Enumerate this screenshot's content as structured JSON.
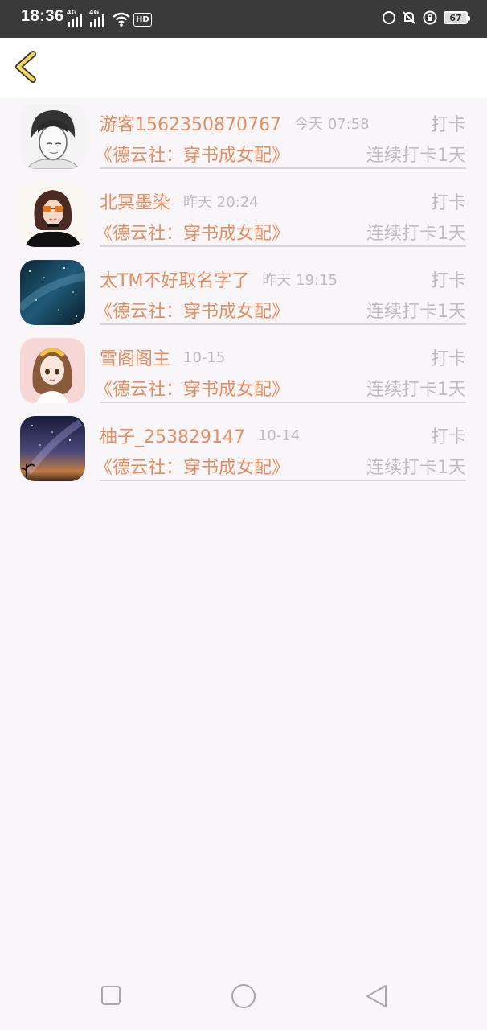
{
  "status_bar": {
    "time": "18:36",
    "network_1": "4G",
    "network_2": "4G",
    "hd": "HD",
    "battery": "67",
    "icons": [
      "signal-icon",
      "signal-icon",
      "wifi-icon",
      "hd-icon",
      "face-icon",
      "bell-off-icon",
      "lock-rotation-icon",
      "battery-icon"
    ]
  },
  "header": {
    "back_icon": "chevron-left-icon",
    "accent_color": "#e8c54a"
  },
  "colors": {
    "name": "#e78d5f",
    "muted": "#bdbdbd",
    "divider": "#d6d6d6",
    "background": "#f8f6f8"
  },
  "checkins": [
    {
      "name": "游客1562350870767",
      "time": "今天 07:58",
      "tag": "打卡",
      "book": "《德云社：穿书成女配》",
      "streak": "连续打卡1天",
      "avatar": "avatar-sketch-boy"
    },
    {
      "name": "北冥墨染",
      "time": "昨天 20:24",
      "tag": "打卡",
      "book": "《德云社：穿书成女配》",
      "streak": "连续打卡1天",
      "avatar": "avatar-girl-sunglasses"
    },
    {
      "name": "太TM不好取名字了",
      "time": "昨天 19:15",
      "tag": "打卡",
      "book": "《德云社：穿书成女配》",
      "streak": "连续打卡1天",
      "avatar": "avatar-starry-sky"
    },
    {
      "name": "雪阁阁主",
      "time": "10-15",
      "tag": "打卡",
      "book": "《德云社：穿书成女配》",
      "streak": "连续打卡1天",
      "avatar": "avatar-cartoon-girl"
    },
    {
      "name": "柚子_253829147",
      "time": "10-14",
      "tag": "打卡",
      "book": "《德云社：穿书成女配》",
      "streak": "连续打卡1天",
      "avatar": "avatar-night-galaxy"
    }
  ],
  "nav_bar": {
    "icons": [
      "square-recents-icon",
      "circle-home-icon",
      "triangle-back-icon"
    ]
  }
}
